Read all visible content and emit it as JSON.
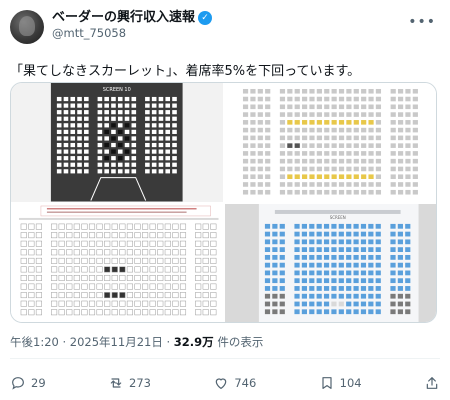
{
  "author": {
    "display_name": "ベーダーの興行収入速報",
    "handle": "@mtt_75058"
  },
  "post": {
    "text": "「果てしなきスカーレット」、着席率5%を下回っています。"
  },
  "media": {
    "screen_label": "SCREEN 10",
    "screen_label_2": "SCREEN"
  },
  "meta": {
    "timestamp": "午後1:20 · 2025年11月21日 · ",
    "views_count": "32.9万",
    "views_label": " 件の表示"
  },
  "actions": {
    "replies": "29",
    "reposts": "273",
    "likes": "746",
    "bookmarks": "104"
  },
  "colors": {
    "verified": "#1d9bf0",
    "muted": "#536471",
    "seat_taken_yellow": "#e8c84a",
    "seat_blue": "#5aa0dc"
  }
}
